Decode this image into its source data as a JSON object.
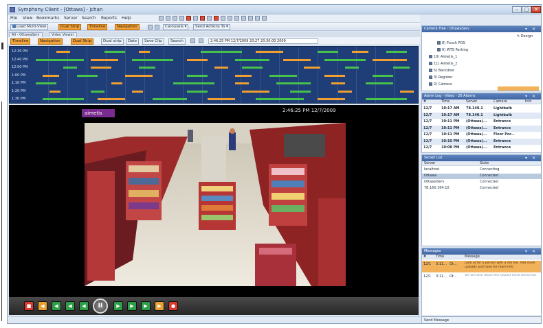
{
  "window": {
    "title": "Symphony Client - [Ottawa] - jchan"
  },
  "menu": [
    "File",
    "View",
    "Bookmarks",
    "Server",
    "Search",
    "Reports",
    "Help"
  ],
  "toolbar1": {
    "load_multiview": "Load Multi-View",
    "dual_strip": "Dual Strip",
    "timeline": "Timeline",
    "navigation": "Navigation",
    "carousels": "Carousels",
    "send_actions": "Send Actions To"
  },
  "tabs": [
    "All - OttawaServ",
    "Video Viewer"
  ],
  "toolbar2": {
    "timeline": "Timeline",
    "navigation": "Navigation",
    "dual_strip": "Dual Strip",
    "dual_strip_note": "Dual strip",
    "date": "Date",
    "save_clip": "Save Clip",
    "search": "Search",
    "datetime_value": "2:46:25 PM 12/7/2009 20:27 20:30:00 2009"
  },
  "timeline": {
    "rows": [
      "12:30 PM",
      "12:40 PM",
      "12:50 PM",
      "1:00 PM",
      "1:10 PM",
      "1:20 PM",
      "1:30 PM"
    ]
  },
  "video": {
    "logo": "aimetis",
    "timestamp": "2:46:25 PM 12/7/2009"
  },
  "playback": {
    "pause_glyph": "II",
    "buttons": [
      {
        "name": "stop-button",
        "glyph": "■",
        "color": "#d93a2c"
      },
      {
        "name": "previous-button",
        "glyph": "◀",
        "color": "#e8a030"
      },
      {
        "name": "rewind-button",
        "glyph": "◀",
        "color": "#2f9e48"
      },
      {
        "name": "step-back-button",
        "glyph": "◀",
        "color": "#2f9e48"
      },
      {
        "name": "frame-back-button",
        "glyph": "◀",
        "color": "#2f9e48"
      },
      {
        "name": "frame-forward-button",
        "glyph": "▶",
        "color": "#2f9e48"
      },
      {
        "name": "step-forward-button",
        "glyph": "▶",
        "color": "#2f9e48"
      },
      {
        "name": "fast-forward-button",
        "glyph": "▶",
        "color": "#2f9e48"
      },
      {
        "name": "next-button",
        "glyph": "▶",
        "color": "#e8a030"
      },
      {
        "name": "live-button",
        "glyph": "●",
        "color": "#d93a2c"
      }
    ]
  },
  "camera_tree": {
    "title": "Camera Tree - OttawaServ",
    "design": "Design",
    "items": [
      "8) Punch POS",
      "9) WTS Parking",
      "10) Aimetis_1",
      "11) Aimetis_2",
      "5) Backdoor",
      "3) Register",
      "2) Camera"
    ]
  },
  "alarm_log": {
    "title": "Alarm Log - Video - 20 Alarms",
    "columns": [
      "#",
      "Time",
      "Server",
      "Camera",
      "Info"
    ],
    "rows": [
      [
        "12/7",
        "10:17 AM",
        "78.140.1",
        "Lightbulb"
      ],
      [
        "12/7",
        "10:17 AM",
        "78.140.1",
        "Lightbulb"
      ],
      [
        "12/7",
        "10:11 PM",
        "(Ottawa)...",
        "Entrance"
      ],
      [
        "12/7",
        "10:11 PM",
        "(Ottawa)...",
        "Entrance"
      ],
      [
        "12/7",
        "10:11 PM",
        "(Ottawa)...",
        "Floor Por..."
      ],
      [
        "12/7",
        "10:10 PM",
        "(Ottawa)...",
        "Entrance"
      ],
      [
        "12/7",
        "10:08 PM",
        "(Ottawa)...",
        "Entrance"
      ]
    ]
  },
  "server_list": {
    "title": "Server List",
    "columns": [
      "Server",
      "State"
    ],
    "rows": [
      [
        "localhost",
        "Connecting"
      ],
      [
        "Ottawa",
        "Connected"
      ],
      [
        "OttawaServ",
        "Connected"
      ],
      [
        "78.160.164.10",
        "Connected"
      ]
    ]
  },
  "messages": {
    "title": "Messages",
    "columns": [
      "#",
      "Time",
      "",
      "Message"
    ],
    "rows": [
      [
        "12/1",
        "3:11...",
        "Ot...",
        "Look at for a person with a red hat. Add store uploads and have for more info"
      ],
      [
        "12/1",
        "3:11...",
        "Ot...",
        "We will also return the unpaid stock tomorrow."
      ]
    ],
    "send": "Send Message"
  },
  "colors": {
    "timeline_bg": "#1f3e78",
    "seg_green": "#47c24a",
    "seg_orange": "#f0a030",
    "panel_head": "#4a70ad",
    "highlight": "#f2b25a"
  }
}
